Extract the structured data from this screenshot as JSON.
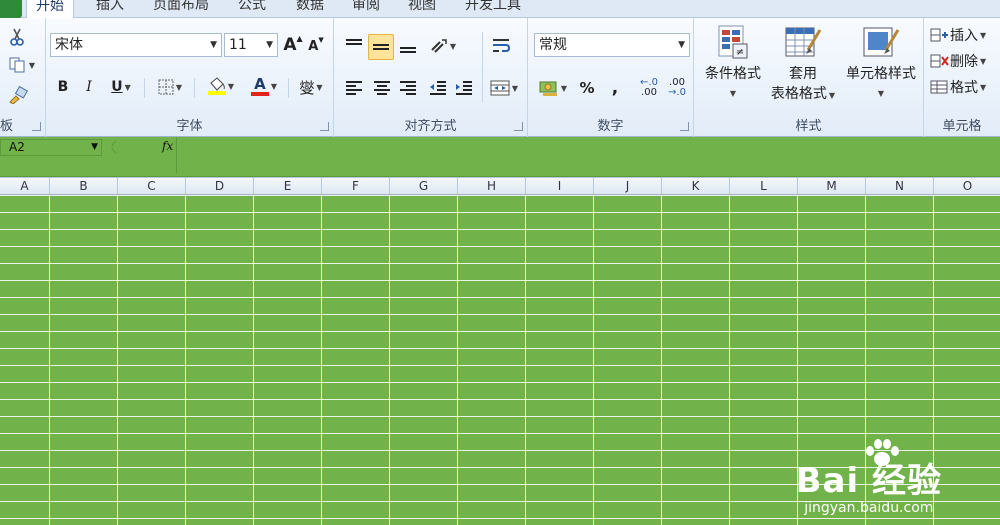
{
  "tabs": [
    {
      "label": "开始"
    },
    {
      "label": "插入"
    },
    {
      "label": "页面布局"
    },
    {
      "label": "公式"
    },
    {
      "label": "数据"
    },
    {
      "label": "审阅"
    },
    {
      "label": "视图"
    },
    {
      "label": "开发工具"
    }
  ],
  "active_tab": "开始",
  "ribbon": {
    "clipboard": {
      "label": "板"
    },
    "font": {
      "label": "字体",
      "font_name": "宋体",
      "font_size": "11",
      "grow": "A",
      "shrink": "A",
      "bold": "B",
      "italic": "I",
      "underline": "U",
      "font_color_glyph": "A",
      "phonetic": "燮"
    },
    "alignment": {
      "label": "对齐方式"
    },
    "number": {
      "label": "数字",
      "format": "常规",
      "percent": "%",
      "comma": ",",
      "inc_decimal": ".00",
      "dec_decimal": ".00"
    },
    "styles": {
      "label": "样式",
      "conditional": "条件格式",
      "table_line1": "套用",
      "table_line2": "表格格式",
      "cell_style": "单元格样式"
    },
    "cells": {
      "label": "单元格",
      "insert": "插入",
      "delete": "删除",
      "format": "格式"
    }
  },
  "formula_bar": {
    "name_box": "A2",
    "fx": "fx",
    "value": ""
  },
  "columns": [
    "A",
    "B",
    "C",
    "D",
    "E",
    "F",
    "G",
    "H",
    "I",
    "J",
    "K",
    "L",
    "M",
    "N",
    "O"
  ],
  "watermark": {
    "brand": "Bai 经验",
    "url": "jingyan.baidu.com"
  },
  "colors": {
    "sheet_fill": "#71b34a",
    "gridline": "#ffffff",
    "fill_color_swatch": "#ffff00",
    "font_color_swatch": "#e3221b"
  }
}
